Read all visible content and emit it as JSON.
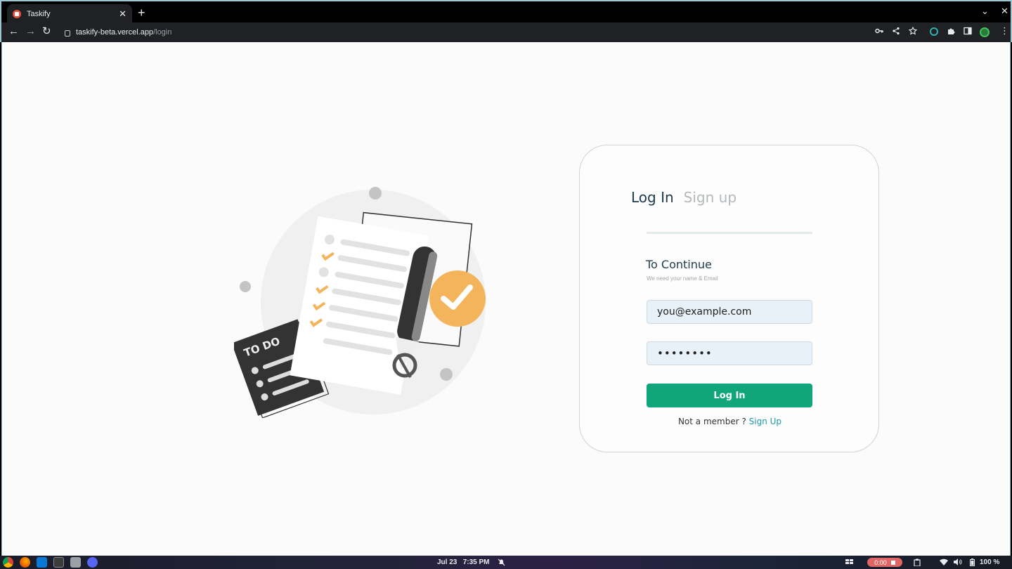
{
  "browser": {
    "tab_title": "Taskify",
    "tab_close": "✕",
    "new_tab": "+",
    "chevron": "⌄",
    "window_close": "✕",
    "url_host": "taskify-beta.vercel.app",
    "url_path": "/login",
    "back": "←",
    "forward": "→",
    "reload": "↻",
    "menu": "⋮"
  },
  "login_card": {
    "tab_login": "Log In",
    "tab_signup": "Sign up",
    "heading": "To Continue",
    "subheading": "We need your name & Email",
    "email_value": "you@example.com",
    "password_value": "••••••••",
    "submit_label": "Log In",
    "member_prompt": "Not a member ?",
    "signup_link": "Sign Up"
  },
  "illustration": {
    "note_label": "TO DO"
  },
  "taskbar": {
    "date": "Jul 23",
    "time": "7:35 PM",
    "record_time": "0:00",
    "battery": "100 %"
  },
  "colors": {
    "accent": "#10a57b",
    "link": "#1a9ba8",
    "heading": "#1d3a4a",
    "illustration_orange": "#f4b45c"
  }
}
